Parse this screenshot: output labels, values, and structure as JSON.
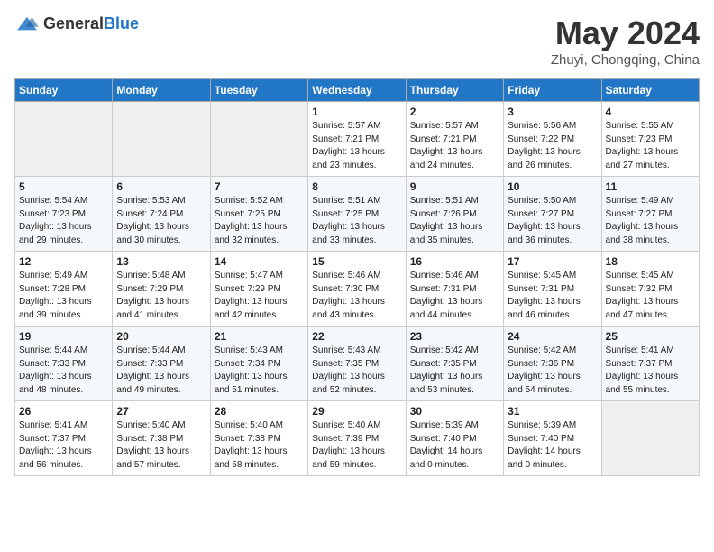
{
  "logo": {
    "text_general": "General",
    "text_blue": "Blue"
  },
  "title": {
    "month_year": "May 2024",
    "location": "Zhuyi, Chongqing, China"
  },
  "weekdays": [
    "Sunday",
    "Monday",
    "Tuesday",
    "Wednesday",
    "Thursday",
    "Friday",
    "Saturday"
  ],
  "weeks": [
    [
      {
        "day": "",
        "sunrise": "",
        "sunset": "",
        "daylight": ""
      },
      {
        "day": "",
        "sunrise": "",
        "sunset": "",
        "daylight": ""
      },
      {
        "day": "",
        "sunrise": "",
        "sunset": "",
        "daylight": ""
      },
      {
        "day": "1",
        "sunrise": "Sunrise: 5:57 AM",
        "sunset": "Sunset: 7:21 PM",
        "daylight": "Daylight: 13 hours and 23 minutes."
      },
      {
        "day": "2",
        "sunrise": "Sunrise: 5:57 AM",
        "sunset": "Sunset: 7:21 PM",
        "daylight": "Daylight: 13 hours and 24 minutes."
      },
      {
        "day": "3",
        "sunrise": "Sunrise: 5:56 AM",
        "sunset": "Sunset: 7:22 PM",
        "daylight": "Daylight: 13 hours and 26 minutes."
      },
      {
        "day": "4",
        "sunrise": "Sunrise: 5:55 AM",
        "sunset": "Sunset: 7:23 PM",
        "daylight": "Daylight: 13 hours and 27 minutes."
      }
    ],
    [
      {
        "day": "5",
        "sunrise": "Sunrise: 5:54 AM",
        "sunset": "Sunset: 7:23 PM",
        "daylight": "Daylight: 13 hours and 29 minutes."
      },
      {
        "day": "6",
        "sunrise": "Sunrise: 5:53 AM",
        "sunset": "Sunset: 7:24 PM",
        "daylight": "Daylight: 13 hours and 30 minutes."
      },
      {
        "day": "7",
        "sunrise": "Sunrise: 5:52 AM",
        "sunset": "Sunset: 7:25 PM",
        "daylight": "Daylight: 13 hours and 32 minutes."
      },
      {
        "day": "8",
        "sunrise": "Sunrise: 5:51 AM",
        "sunset": "Sunset: 7:25 PM",
        "daylight": "Daylight: 13 hours and 33 minutes."
      },
      {
        "day": "9",
        "sunrise": "Sunrise: 5:51 AM",
        "sunset": "Sunset: 7:26 PM",
        "daylight": "Daylight: 13 hours and 35 minutes."
      },
      {
        "day": "10",
        "sunrise": "Sunrise: 5:50 AM",
        "sunset": "Sunset: 7:27 PM",
        "daylight": "Daylight: 13 hours and 36 minutes."
      },
      {
        "day": "11",
        "sunrise": "Sunrise: 5:49 AM",
        "sunset": "Sunset: 7:27 PM",
        "daylight": "Daylight: 13 hours and 38 minutes."
      }
    ],
    [
      {
        "day": "12",
        "sunrise": "Sunrise: 5:49 AM",
        "sunset": "Sunset: 7:28 PM",
        "daylight": "Daylight: 13 hours and 39 minutes."
      },
      {
        "day": "13",
        "sunrise": "Sunrise: 5:48 AM",
        "sunset": "Sunset: 7:29 PM",
        "daylight": "Daylight: 13 hours and 41 minutes."
      },
      {
        "day": "14",
        "sunrise": "Sunrise: 5:47 AM",
        "sunset": "Sunset: 7:29 PM",
        "daylight": "Daylight: 13 hours and 42 minutes."
      },
      {
        "day": "15",
        "sunrise": "Sunrise: 5:46 AM",
        "sunset": "Sunset: 7:30 PM",
        "daylight": "Daylight: 13 hours and 43 minutes."
      },
      {
        "day": "16",
        "sunrise": "Sunrise: 5:46 AM",
        "sunset": "Sunset: 7:31 PM",
        "daylight": "Daylight: 13 hours and 44 minutes."
      },
      {
        "day": "17",
        "sunrise": "Sunrise: 5:45 AM",
        "sunset": "Sunset: 7:31 PM",
        "daylight": "Daylight: 13 hours and 46 minutes."
      },
      {
        "day": "18",
        "sunrise": "Sunrise: 5:45 AM",
        "sunset": "Sunset: 7:32 PM",
        "daylight": "Daylight: 13 hours and 47 minutes."
      }
    ],
    [
      {
        "day": "19",
        "sunrise": "Sunrise: 5:44 AM",
        "sunset": "Sunset: 7:33 PM",
        "daylight": "Daylight: 13 hours and 48 minutes."
      },
      {
        "day": "20",
        "sunrise": "Sunrise: 5:44 AM",
        "sunset": "Sunset: 7:33 PM",
        "daylight": "Daylight: 13 hours and 49 minutes."
      },
      {
        "day": "21",
        "sunrise": "Sunrise: 5:43 AM",
        "sunset": "Sunset: 7:34 PM",
        "daylight": "Daylight: 13 hours and 51 minutes."
      },
      {
        "day": "22",
        "sunrise": "Sunrise: 5:43 AM",
        "sunset": "Sunset: 7:35 PM",
        "daylight": "Daylight: 13 hours and 52 minutes."
      },
      {
        "day": "23",
        "sunrise": "Sunrise: 5:42 AM",
        "sunset": "Sunset: 7:35 PM",
        "daylight": "Daylight: 13 hours and 53 minutes."
      },
      {
        "day": "24",
        "sunrise": "Sunrise: 5:42 AM",
        "sunset": "Sunset: 7:36 PM",
        "daylight": "Daylight: 13 hours and 54 minutes."
      },
      {
        "day": "25",
        "sunrise": "Sunrise: 5:41 AM",
        "sunset": "Sunset: 7:37 PM",
        "daylight": "Daylight: 13 hours and 55 minutes."
      }
    ],
    [
      {
        "day": "26",
        "sunrise": "Sunrise: 5:41 AM",
        "sunset": "Sunset: 7:37 PM",
        "daylight": "Daylight: 13 hours and 56 minutes."
      },
      {
        "day": "27",
        "sunrise": "Sunrise: 5:40 AM",
        "sunset": "Sunset: 7:38 PM",
        "daylight": "Daylight: 13 hours and 57 minutes."
      },
      {
        "day": "28",
        "sunrise": "Sunrise: 5:40 AM",
        "sunset": "Sunset: 7:38 PM",
        "daylight": "Daylight: 13 hours and 58 minutes."
      },
      {
        "day": "29",
        "sunrise": "Sunrise: 5:40 AM",
        "sunset": "Sunset: 7:39 PM",
        "daylight": "Daylight: 13 hours and 59 minutes."
      },
      {
        "day": "30",
        "sunrise": "Sunrise: 5:39 AM",
        "sunset": "Sunset: 7:40 PM",
        "daylight": "Daylight: 14 hours and 0 minutes."
      },
      {
        "day": "31",
        "sunrise": "Sunrise: 5:39 AM",
        "sunset": "Sunset: 7:40 PM",
        "daylight": "Daylight: 14 hours and 0 minutes."
      },
      {
        "day": "",
        "sunrise": "",
        "sunset": "",
        "daylight": ""
      }
    ]
  ]
}
